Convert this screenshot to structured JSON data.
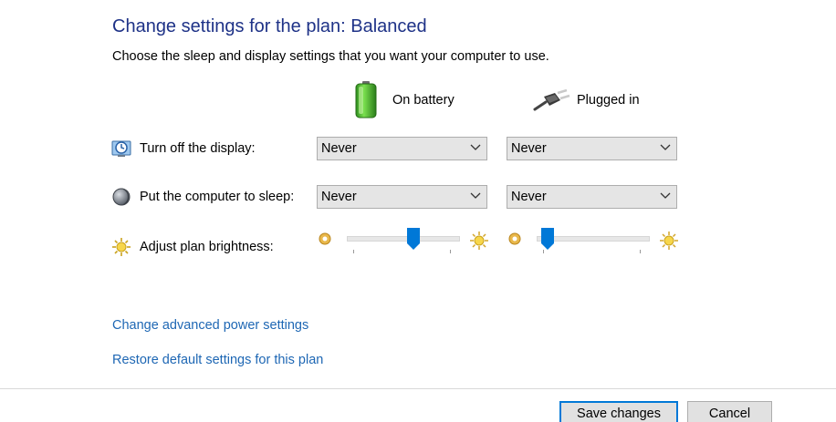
{
  "header": {
    "title": "Change settings for the plan: Balanced",
    "subtitle": "Choose the sleep and display settings that you want your computer to use."
  },
  "columns": {
    "battery": {
      "label": "On battery",
      "icon": "battery-icon"
    },
    "plugged": {
      "label": "Plugged in",
      "icon": "power-plug-icon"
    }
  },
  "rows": {
    "display": {
      "label": "Turn off the display:",
      "icon": "display-clock-icon",
      "battery_value": "Never",
      "plugged_value": "Never"
    },
    "sleep": {
      "label": "Put the computer to sleep:",
      "icon": "moon-sleep-icon",
      "battery_value": "Never",
      "plugged_value": "Never"
    },
    "brightness": {
      "label": "Adjust plan brightness:",
      "icon": "sun-brightness-icon",
      "battery_level": 0.6,
      "plugged_level": 0.1
    }
  },
  "links": {
    "advanced": "Change advanced power settings",
    "restore": "Restore default settings for this plan"
  },
  "buttons": {
    "save": "Save changes",
    "cancel": "Cancel"
  },
  "colors": {
    "title": "#1e3287",
    "link": "#1e67b4",
    "accent": "#0078d7",
    "slider_thumb": "#0078d7"
  }
}
